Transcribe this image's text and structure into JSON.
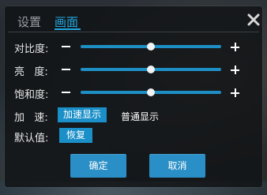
{
  "tabs": [
    {
      "label": "设置",
      "active": false
    },
    {
      "label": "画面",
      "active": true
    }
  ],
  "icons": {
    "close": "close-icon"
  },
  "adjustments": [
    {
      "label": "对比度:",
      "value": 0.5
    },
    {
      "label": "亮   度:",
      "value": 0.5
    },
    {
      "label": "饱和度:",
      "value": 0.5
    }
  ],
  "accel": {
    "label": "加   速:",
    "options": [
      "加速显示",
      "普通显示"
    ],
    "selected": "加速显示"
  },
  "defaults": {
    "label": "默认值:",
    "restore_label": "恢复"
  },
  "buttons": {
    "ok": "确定",
    "cancel": "取消"
  },
  "colors": {
    "accent": "#20a8e0",
    "slider": "#1e8fc4",
    "button": "#2a8fc6"
  }
}
